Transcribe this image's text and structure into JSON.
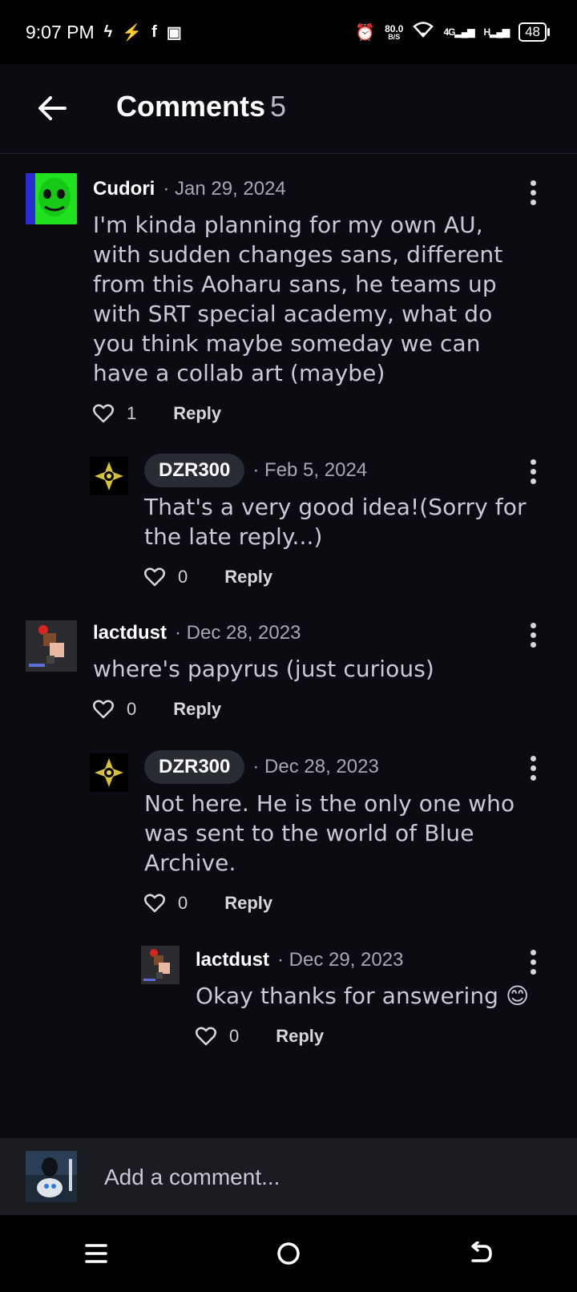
{
  "status_bar": {
    "time": "9:07 PM",
    "speed_value": "80.0",
    "speed_unit": "B/S",
    "network": "4G",
    "network2": "H",
    "battery": "48"
  },
  "header": {
    "title": "Comments",
    "count": "5"
  },
  "comments": [
    {
      "author": "Cudori",
      "date": "· Jan 29, 2024",
      "text": "I'm kinda planning for my own AU, with sudden changes sans, different from this Aoharu sans, he teams up with SRT special academy, what do you think maybe someday we can have a collab art (maybe)",
      "likes": "1",
      "reply_label": "Reply"
    },
    {
      "author": "DZR300",
      "date": "· Feb 5, 2024",
      "text": "That's a very good idea!(Sorry for the late reply...)",
      "likes": "0",
      "reply_label": "Reply"
    },
    {
      "author": "lactdust",
      "date": "· Dec 28, 2023",
      "text": "where's papyrus (just curious)",
      "likes": "0",
      "reply_label": "Reply"
    },
    {
      "author": "DZR300",
      "date": "· Dec 28, 2023",
      "text": "Not here. He is the only one who was sent to the world of Blue Archive.",
      "likes": "0",
      "reply_label": "Reply"
    },
    {
      "author": "lactdust",
      "date": "· Dec 29, 2023",
      "text": "Okay thanks for answering 😊",
      "likes": "0",
      "reply_label": "Reply"
    }
  ],
  "comment_input": {
    "placeholder": "Add a comment..."
  },
  "icons": {
    "back": "back-arrow-icon",
    "like": "heart-icon",
    "more": "more-vertical-icon",
    "nav_menu": "menu-icon",
    "nav_home": "home-icon",
    "nav_back": "back-icon"
  }
}
